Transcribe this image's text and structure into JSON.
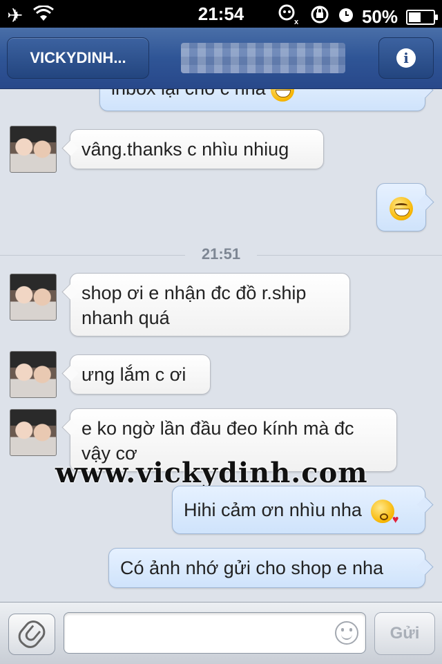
{
  "status_bar": {
    "time": "21:54",
    "battery_percent": "50%",
    "battery_level": 0.5,
    "icons": [
      "airplane-mode-icon",
      "wifi-icon",
      "no-sim-icon",
      "rotation-lock-icon",
      "alarm-icon"
    ]
  },
  "nav": {
    "back_label": "VICKYDINH...",
    "title": "",
    "info_icon_label": "i"
  },
  "messages": [
    {
      "side": "out",
      "text": "inbox lại cho c nha",
      "emoji": "grin",
      "partial": true
    },
    {
      "side": "in",
      "text": "vâng.thanks c nhìu nhiug"
    },
    {
      "side": "out",
      "text": "",
      "emoji": "grin"
    },
    {
      "side": "in",
      "text": "shop ơi e nhận đc đồ r.ship nhanh quá"
    },
    {
      "side": "in",
      "text": "ưng lắm c ơi"
    },
    {
      "side": "in",
      "text": "e ko ngờ lần đầu đeo kính mà đc vậy cơ"
    },
    {
      "side": "out",
      "text": "Hihi cảm ơn nhìu nha",
      "emoji": "kiss"
    },
    {
      "side": "out",
      "text": "Có ảnh nhớ gửi cho shop e nha"
    }
  ],
  "timestamp": "21:51",
  "watermark": "www.vickydinh.com",
  "composer": {
    "input_value": "",
    "send_label": "Gửi"
  },
  "colors": {
    "navbar": "#2f5596",
    "background": "#dde2ea",
    "outgoing_bubble": "#d6e7fc",
    "incoming_bubble": "#ffffff"
  }
}
